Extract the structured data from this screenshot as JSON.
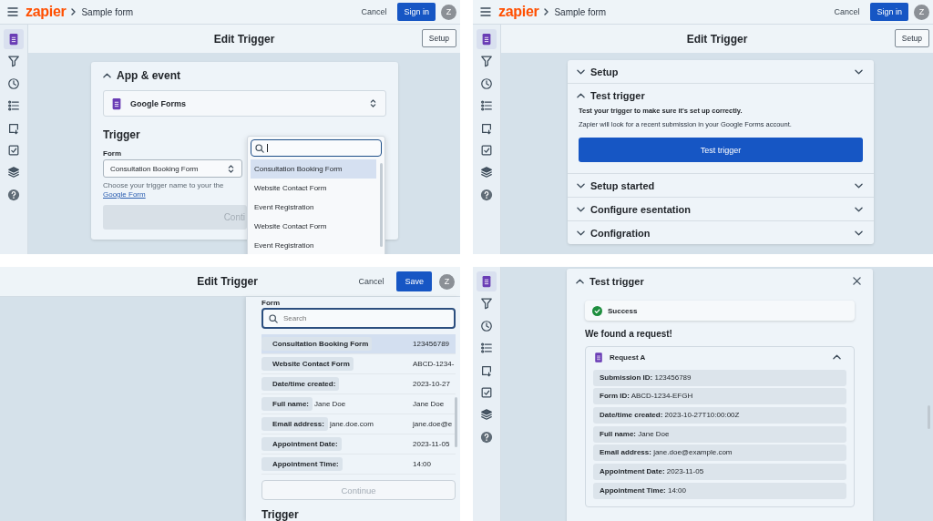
{
  "panels": [
    {
      "kind": "form_select",
      "header": {
        "logo": "zapier",
        "breadcrumb": "Sample form",
        "cancel": "Cancel",
        "sign_in": "Sign in",
        "avatar": "Z"
      },
      "sidebar": [
        {
          "selected": true
        },
        {
          "selected": false
        },
        {
          "selected": false
        },
        {
          "selected": false
        },
        {
          "selected": false
        },
        {
          "selected": false
        },
        {
          "selected": false
        },
        {
          "selected": false
        }
      ],
      "title": "Edit Trigger",
      "setup_button": "Setup",
      "card": {
        "section": "App & event",
        "expanded": true,
        "app": "Google Forms",
        "trigger_heading": "Trigger",
        "form_label": "Form",
        "form_value": "Consultation Booking Form",
        "helper": "Choose your trigger name to your the ",
        "helper_link": "Google Form",
        "continue": {
          "label": "Conti",
          "disabled": true
        }
      },
      "dropdown": {
        "items": [
          {
            "label": "Consultation Booking Form",
            "selected": true
          },
          {
            "label": "Website Contact Form",
            "selected": false
          },
          {
            "label": "Event Registration",
            "selected": false
          },
          {
            "label": "Website Contact Form",
            "selected": false
          },
          {
            "label": "Event Registration",
            "selected": false
          }
        ]
      }
    },
    {
      "kind": "test_setup",
      "header": {
        "logo": "zapier",
        "breadcrumb": "Sample form",
        "cancel": "Cancel",
        "sign_in": "Sign in",
        "avatar": "Z"
      },
      "sidebar": [
        {
          "selected": true
        },
        {
          "selected": false
        },
        {
          "selected": false
        },
        {
          "selected": false
        },
        {
          "selected": false
        },
        {
          "selected": false
        },
        {
          "selected": false
        },
        {
          "selected": false
        }
      ],
      "title": "Edit Trigger",
      "setup_button": "Setup",
      "sections": [
        {
          "title": "Setup",
          "expanded": false
        },
        {
          "title": "Test trigger",
          "expanded": true,
          "lead": "Test your trigger to make sure it's set up correctly.",
          "note": "Zapier will look for a recent submission in your Google Forms account.",
          "button": "Test trigger"
        },
        {
          "title": "Setup started",
          "expanded": false
        },
        {
          "title": "Configure esentation",
          "expanded": false
        },
        {
          "title": "Configration",
          "expanded": false
        }
      ]
    },
    {
      "kind": "form_list",
      "title": "Edit Trigger",
      "cancel": "Cancel",
      "save": "Save",
      "avatar": "Z",
      "form_label": "Form",
      "search_placeholder": "Search",
      "rows": [
        {
          "label": "Consultation Booking Form",
          "value": "123456789",
          "selected": true
        },
        {
          "label": "Website Contact Form",
          "value": "ABCD-1234-",
          "selected": false
        },
        {
          "label": "Date/time created:",
          "value": "2023-10-27",
          "selected": false
        },
        {
          "label": "Full name:",
          "detail": "Jane Doe",
          "value": "Jane Doe",
          "selected": false
        },
        {
          "label": "Email address:",
          "detail": "jane.doe.com",
          "value": "jane.doe@e",
          "selected": false
        },
        {
          "label": "Appointment Date:",
          "value": "2023-11-05",
          "selected": false
        },
        {
          "label": "Appointment Time:",
          "value": "14:00",
          "selected": false
        }
      ],
      "continue": {
        "label": "Continue",
        "disabled": true
      },
      "next_heading": "Trigger"
    },
    {
      "kind": "test_result",
      "sidebar": [
        {
          "selected": true
        },
        {
          "selected": false
        },
        {
          "selected": false
        },
        {
          "selected": false
        },
        {
          "selected": false
        },
        {
          "selected": false
        },
        {
          "selected": false
        },
        {
          "selected": false
        }
      ],
      "section": {
        "title": "Test trigger",
        "expanded": true
      },
      "status": "Success",
      "headline": "We found a request!",
      "request": {
        "title": "Request A",
        "expanded": true,
        "fields": [
          "**Submission ID:** 123456789",
          "**Form ID:** ABCD-1234-EFGH",
          "**Date/time created:** 2023-10-27T10:00:00Z",
          "**Full name:** Jane Doe",
          "**Email address:** jane.doe@example.com",
          "**Appointment Date:** 2023-11-05",
          "**Appointment Time:** 14:00"
        ]
      }
    }
  ]
}
